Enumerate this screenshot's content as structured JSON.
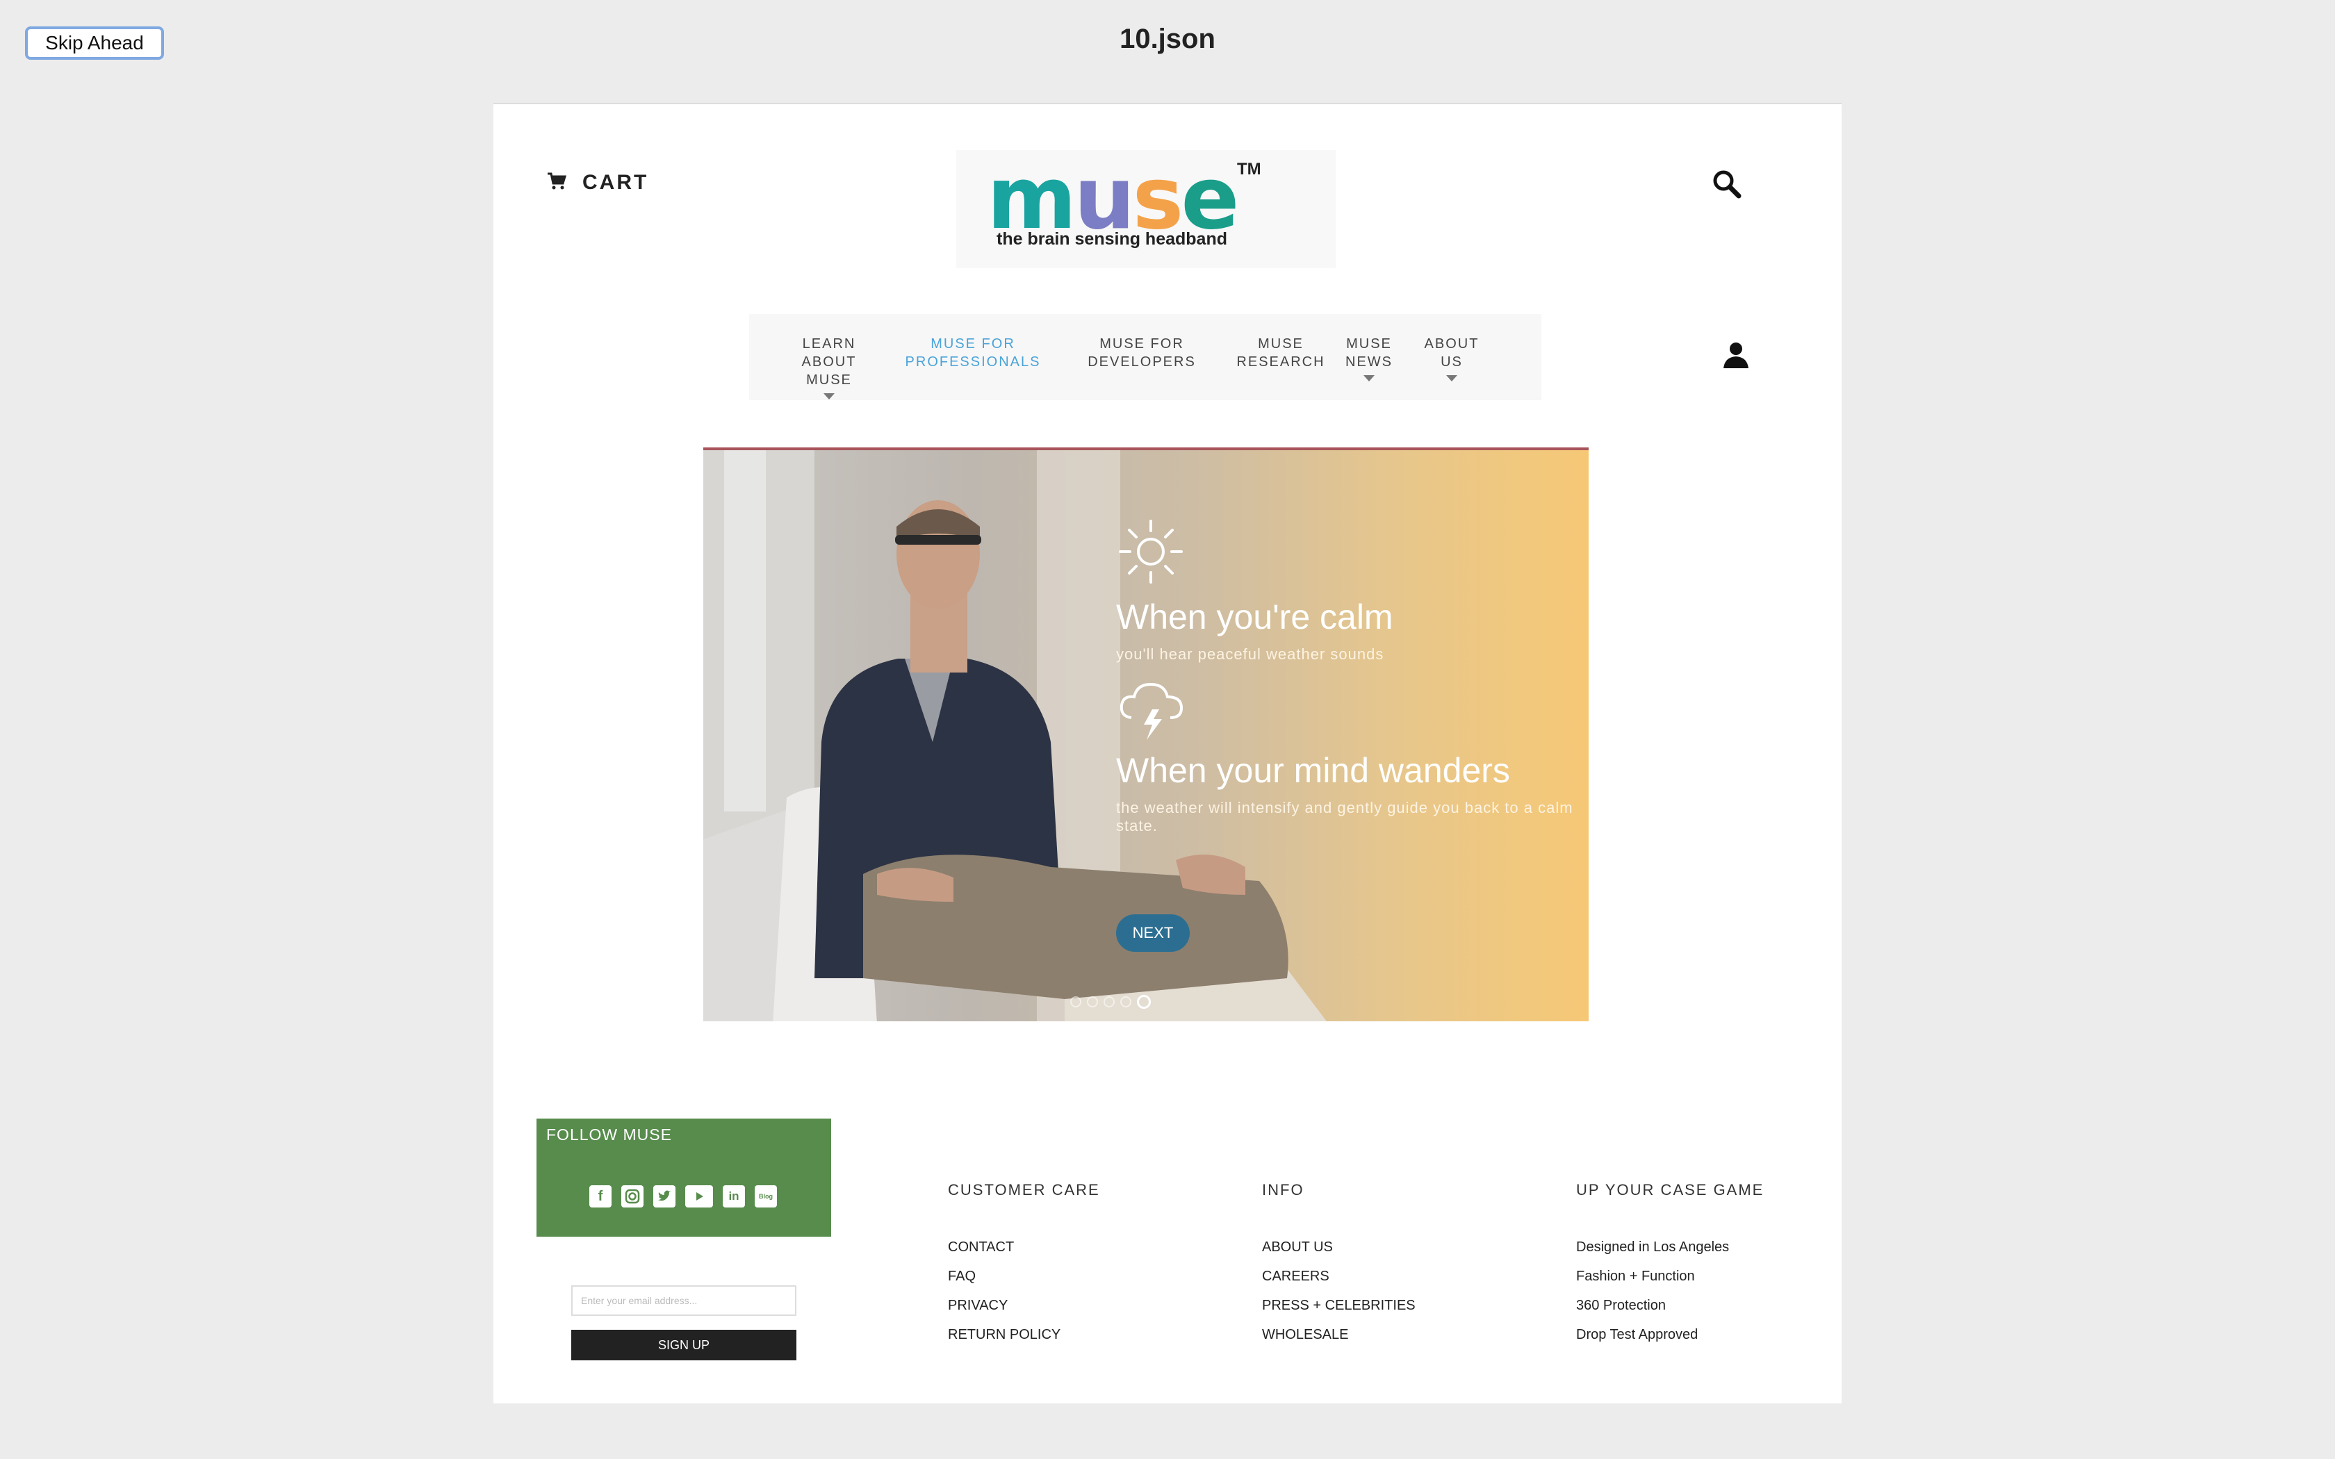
{
  "toolbar": {
    "skip_label": "Skip Ahead",
    "file_title": "10.json"
  },
  "header": {
    "cart_label": "CART",
    "logo": {
      "wordmark": [
        "m",
        "u",
        "s",
        "e"
      ],
      "tm": "TM",
      "tagline": "the brain sensing headband"
    }
  },
  "nav": {
    "items": [
      {
        "label": "LEARN ABOUT MUSE",
        "line1": "LEARN ABOUT",
        "line2": "MUSE",
        "has_dropdown": true
      },
      {
        "label": "MUSE FOR PROFESSIONALS",
        "line1": "MUSE FOR",
        "line2": "PROFESSIONALS",
        "active": true
      },
      {
        "label": "MUSE FOR DEVELOPERS",
        "line1": "MUSE FOR",
        "line2": "DEVELOPERS"
      },
      {
        "label": "MUSE RESEARCH",
        "line1": "MUSE",
        "line2": "RESEARCH"
      },
      {
        "label": "MUSE NEWS",
        "line1": "MUSE",
        "line2": "NEWS",
        "has_dropdown": true
      },
      {
        "label": "ABOUT US",
        "line1": "ABOUT",
        "line2": "US",
        "has_dropdown": true
      }
    ]
  },
  "hero": {
    "calm_heading": "When you're calm",
    "calm_sub": "you'll hear peaceful weather sounds",
    "wander_heading": "When your mind wanders",
    "wander_sub": "the weather will intensify and gently guide you back to a calm state.",
    "next_label": "NEXT",
    "slide_count": 5,
    "active_slide": 5
  },
  "footer": {
    "follow_title": "FOLLOW MUSE",
    "social_icons": [
      "facebook-icon",
      "instagram-icon",
      "twitter-icon",
      "youtube-icon",
      "linkedin-icon",
      "blog-icon"
    ],
    "blog_label": "Blog",
    "email_placeholder": "Enter your email address...",
    "signup_label": "SIGN UP",
    "columns": [
      {
        "title": "CUSTOMER CARE",
        "items": [
          "CONTACT",
          "FAQ",
          "PRIVACY",
          "RETURN POLICY"
        ]
      },
      {
        "title": "INFO",
        "items": [
          "ABOUT US",
          "CAREERS",
          "PRESS + CELEBRITIES",
          "WHOLESALE"
        ]
      },
      {
        "title": "UP YOUR CASE GAME",
        "items": [
          "Designed in Los Angeles",
          "Fashion + Function",
          "360 Protection",
          "Drop Test Approved"
        ]
      }
    ]
  },
  "colors": {
    "accent_blue": "#4aa3d8",
    "follow_green": "#578c4c",
    "next_button": "#2c6e92",
    "hero_warm": "#f6c876"
  }
}
